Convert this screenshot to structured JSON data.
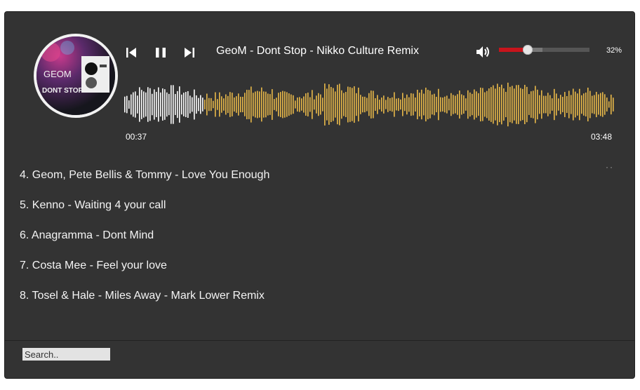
{
  "player": {
    "now_playing": "GeoM - Dont Stop - Nikko Culture Remix",
    "cover_text": [
      "GEOM",
      "DONT STOP"
    ],
    "current_time": "00:37",
    "duration": "03:48",
    "progress": 0.162,
    "volume_label": "32%",
    "volume": 0.32,
    "volume_buffered": 0.48,
    "colors": {
      "background": "#333333",
      "played": "#ffffff",
      "unplayed": "#e9b949",
      "volume": "#c8141c"
    },
    "icons": {
      "prev": "skip-previous-icon",
      "pause": "pause-icon",
      "next": "skip-next-icon",
      "volume": "volume-icon"
    }
  },
  "playlist": [
    "4. Geom, Pete Bellis & Tommy - Love You Enough",
    "5. Kenno - Waiting 4 your call",
    "6. Anagramma - Dont Mind",
    "7. Costa Mee - Feel your love",
    "8. Tosel & Hale - Miles Away - Mark Lower Remix"
  ],
  "search": {
    "placeholder": "Search.."
  }
}
